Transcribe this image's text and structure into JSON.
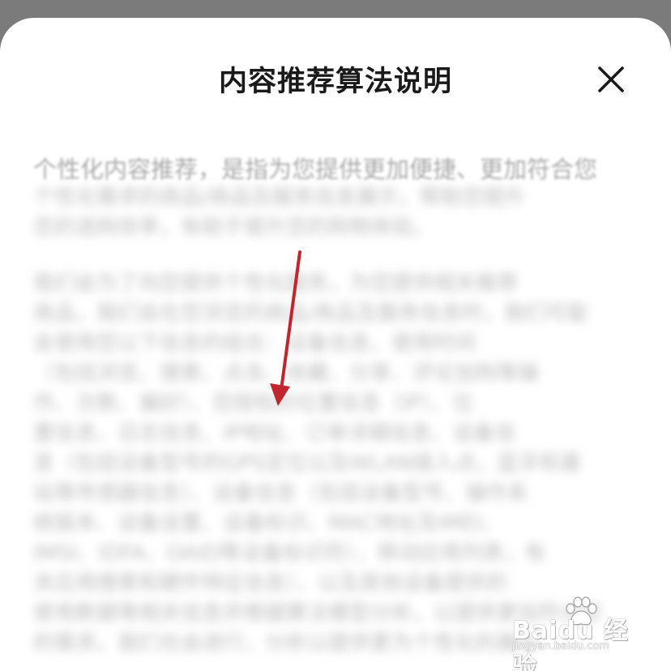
{
  "dialog": {
    "title": "内容推荐算法说明",
    "lead_text": "个性化内容推荐，是指为您提供更加便捷、更加符合您",
    "paragraph1_lines": [
      "个性化需求的商品/商品及服务信息展示，帮助您提升",
      "您的选购效率，有助于提升您的购物体验。"
    ],
    "paragraph2_lines": [
      "我们会为了向您提供个性化服务，为您提供相关推荐",
      "商品，我们会在您浏览的商品/商品及服务信息时，我们可能",
      "会使用您以下信息的组合：设备信息、使用时间",
      "（包括浏览、搜索、点击、收藏、分享、评论加购等操",
      "作、次数、偏好）、您授权的位置信息（IP）、位",
      "置信息、日志信息、IP地址、订单详细信息、设备信",
      "息（包括设备型号的GPS定位以及WLAN接入点，蓝牙和基",
      "站等传感器信息）、设备信息（包括设备型号、操作系",
      "统版本、设备设置、设备标识、MAC地址及IMEI、",
      "IMSI、IDFA、OAID等设备标识符）、移动应用列表，有",
      "关应用搜索和硬件特征信息）、以及其他设备提供的",
      "使用数据等相关信息并根据算法模型分析，以提供更加符合您",
      "的需求。我们也会进行，分析以提供更为个性化的展示"
    ]
  },
  "icons": {
    "close": "close-icon",
    "arrow": "arrow-down-icon",
    "watermark_logo": "paw-logo-icon"
  },
  "colors": {
    "accent_arrow": "#c0262d",
    "title": "#1a1a1a",
    "backdrop": "#7b7b7b"
  },
  "watermark": {
    "url": "jingyan.baidu.com"
  }
}
